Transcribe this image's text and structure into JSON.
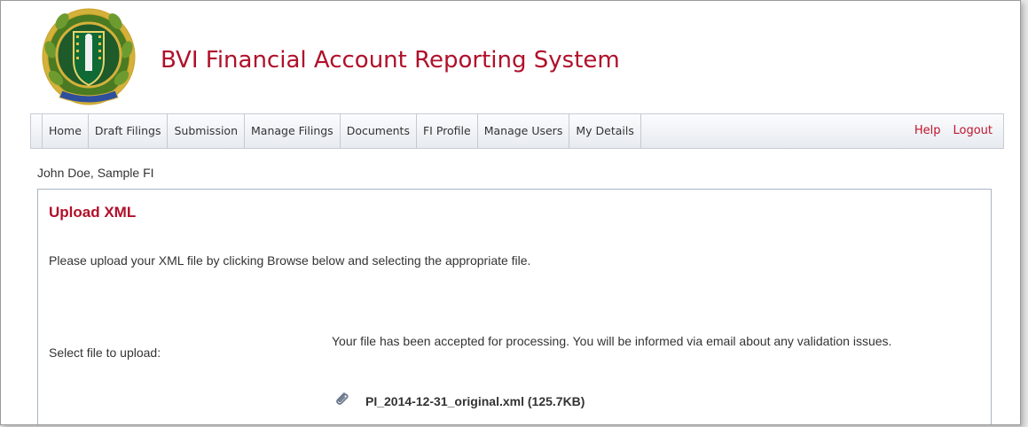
{
  "app": {
    "title": "BVI Financial Account Reporting System"
  },
  "nav": {
    "items": [
      {
        "label": "Home"
      },
      {
        "label": "Draft Filings"
      },
      {
        "label": "Submission"
      },
      {
        "label": "Manage Filings"
      },
      {
        "label": "Documents"
      },
      {
        "label": "FI Profile"
      },
      {
        "label": "Manage Users"
      },
      {
        "label": "My Details"
      }
    ],
    "help": "Help",
    "logout": "Logout"
  },
  "user": {
    "line": "John Doe, Sample FI"
  },
  "panel": {
    "title": "Upload XML",
    "instructions": "Please upload your XML file by clicking Browse below and selecting the appropriate file.",
    "select_label": "Select file to upload:",
    "result_message": "Your file has been accepted for processing. You will be informed via email about any validation issues.",
    "file": {
      "name": "PI_2014-12-31_original.xml (125.7KB)",
      "icon": "paperclip-icon"
    }
  },
  "colors": {
    "brand_red": "#b0102a",
    "nav_link_red": "#c0142d",
    "text": "#333333",
    "panel_border": "#a9b6c4"
  }
}
